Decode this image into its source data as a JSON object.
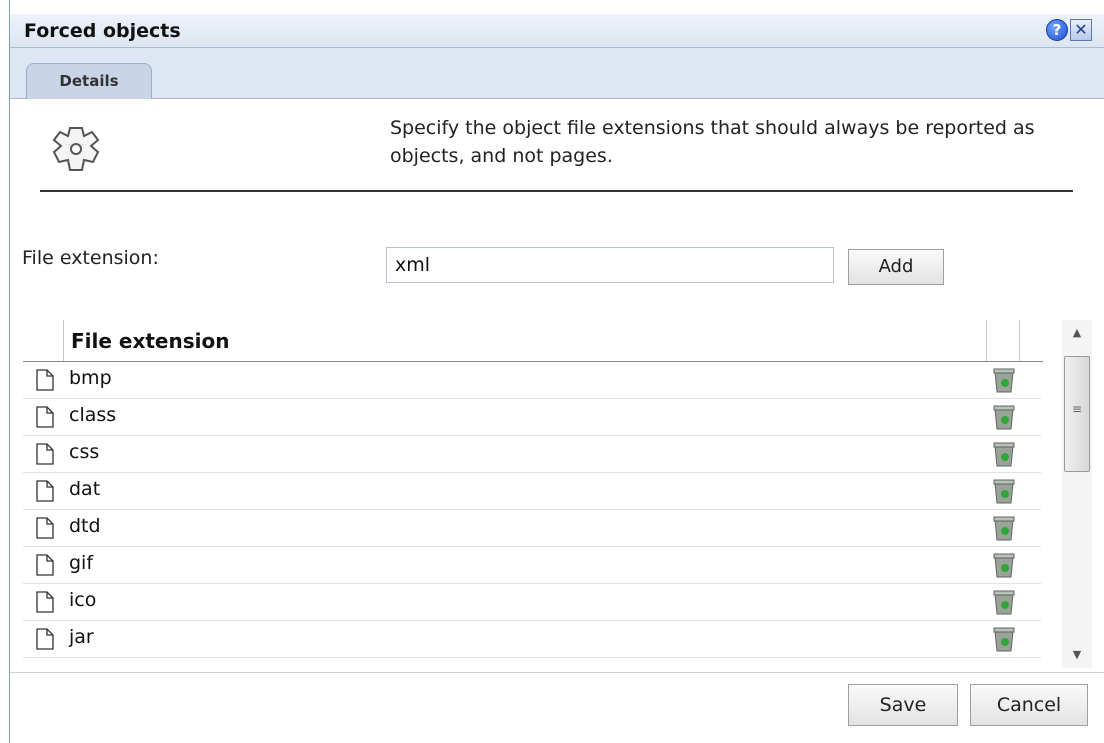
{
  "dialog": {
    "title": "Forced objects"
  },
  "tabs": [
    {
      "label": "Details"
    }
  ],
  "description": "Specify the object file extensions that should always be reported as objects, and not pages.",
  "form": {
    "file_extension_label": "File extension:",
    "file_extension_value": "xml",
    "add_label": "Add"
  },
  "grid": {
    "column_header": "File extension",
    "rows": [
      {
        "extension": "bmp"
      },
      {
        "extension": "class"
      },
      {
        "extension": "css"
      },
      {
        "extension": "dat"
      },
      {
        "extension": "dtd"
      },
      {
        "extension": "gif"
      },
      {
        "extension": "ico"
      },
      {
        "extension": "jar"
      }
    ]
  },
  "footer": {
    "save_label": "Save",
    "cancel_label": "Cancel"
  },
  "icons": {
    "help": "help-icon",
    "close": "close-icon",
    "gear": "gear-icon",
    "file": "file-icon",
    "delete": "trash-icon"
  }
}
